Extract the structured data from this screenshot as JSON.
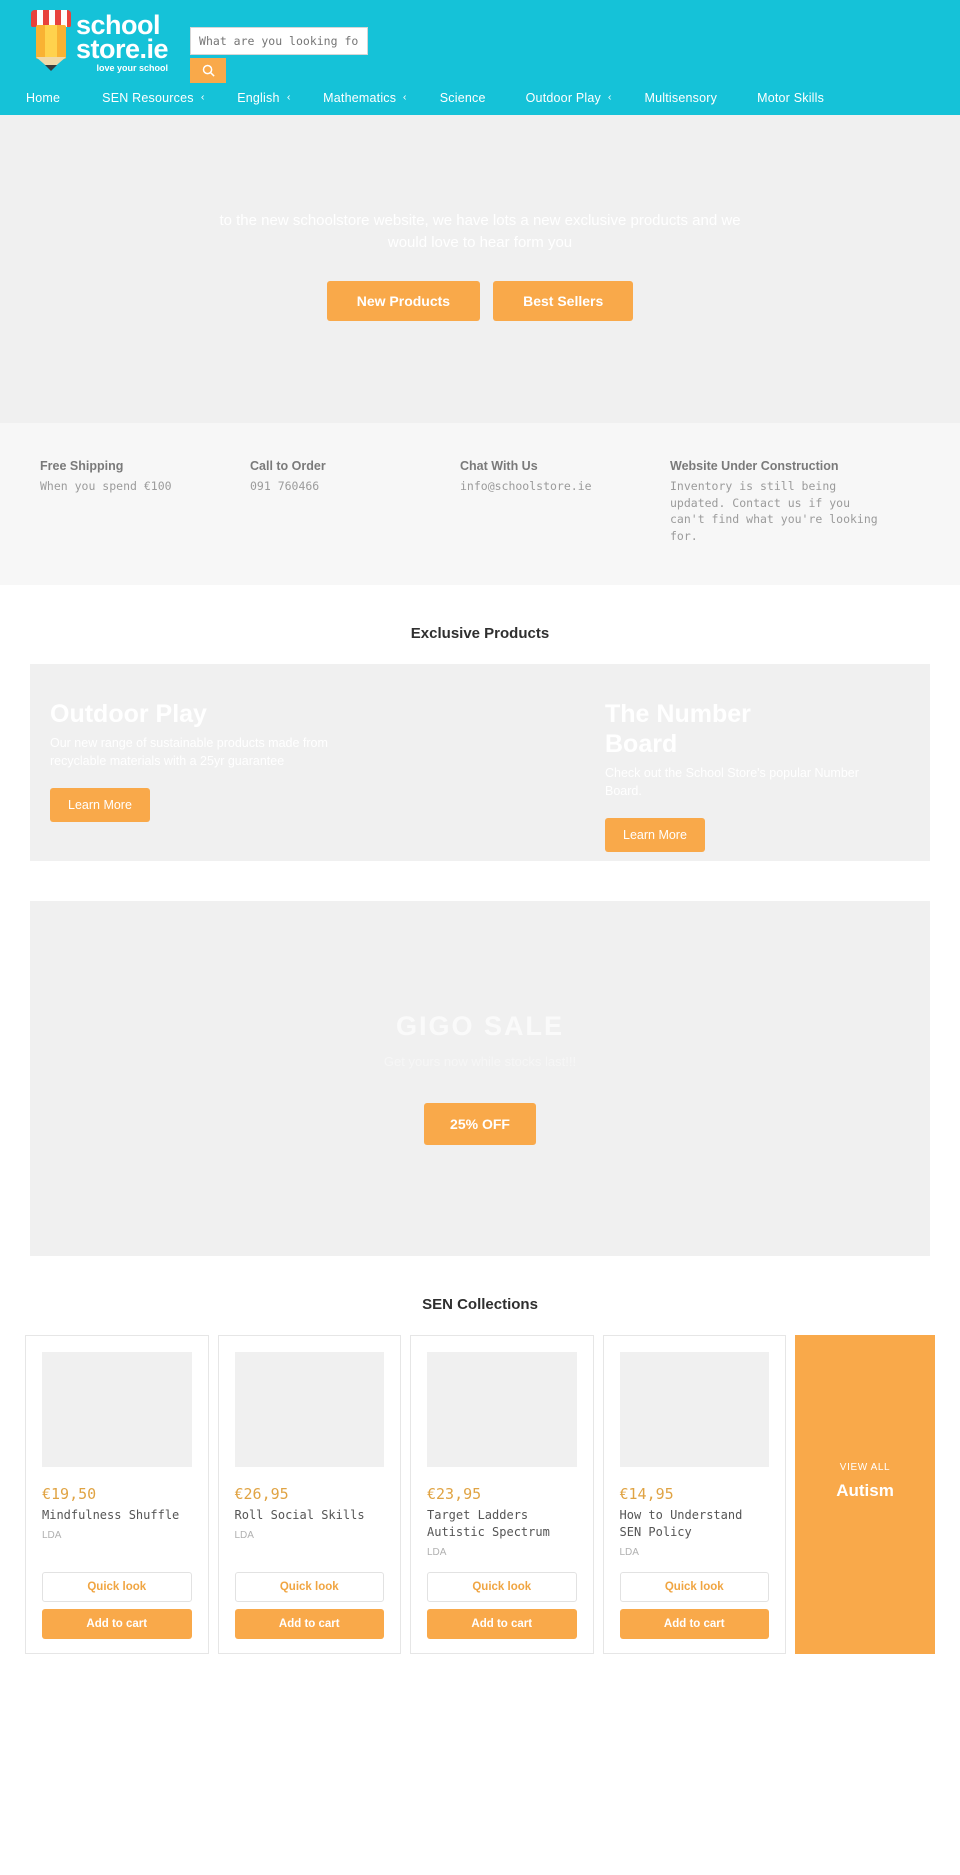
{
  "header": {
    "brand_line1": "school",
    "brand_line2": "store.ie",
    "brand_tagline": "love your school",
    "search_placeholder": "What are you looking for?",
    "search_value": "",
    "colors": {
      "teal": "#15c2d8",
      "orange": "#f9a94a",
      "price": "#e0a343"
    }
  },
  "nav": {
    "items": [
      {
        "label": "Home",
        "caret": ""
      },
      {
        "label": "SEN Resources",
        "caret": "‹"
      },
      {
        "label": "English",
        "caret": "‹"
      },
      {
        "label": "Mathematics",
        "caret": "‹"
      },
      {
        "label": "Science",
        "caret": ""
      },
      {
        "label": "Outdoor Play",
        "caret": "‹"
      },
      {
        "label": "Multisensory",
        "caret": ""
      },
      {
        "label": "Motor Skills",
        "caret": ""
      }
    ]
  },
  "hero": {
    "text": "to the new schoolstore website, we have lots a new exclusive products and we would love to hear form you",
    "button_primary": "New Products",
    "button_secondary": "Best Sellers"
  },
  "infobar": {
    "columns": [
      {
        "title": "Free Shipping",
        "sub": "When you spend €100"
      },
      {
        "title": "Call to Order",
        "sub": "091 760466"
      },
      {
        "title": "Chat With Us",
        "sub": "info@schoolstore.ie"
      },
      {
        "title": "Website Under Construction",
        "sub": "Inventory is still being updated. Contact us if you can't find what you're looking for."
      }
    ]
  },
  "exclusive": {
    "heading": "Exclusive Products",
    "banners": [
      {
        "title": "Outdoor Play",
        "body": "Our new range of sustainable products made from recyclable materials with a 25yr guarantee",
        "cta": "Learn More"
      },
      {
        "title": "The Number Board",
        "body": "Check out the School Store's popular Number Board.",
        "cta": "Learn More"
      }
    ]
  },
  "sale": {
    "title": "GIGO SALE",
    "subtitle": "Get yours now while stocks last!!!",
    "cta": "25% OFF"
  },
  "collections": {
    "heading": "SEN Collections",
    "quick_look_label": "Quick look",
    "add_to_cart_label": "Add to cart",
    "products": [
      {
        "price": "€19,50",
        "name": "Mindfulness Shuffle",
        "brand": "LDA"
      },
      {
        "price": "€26,95",
        "name": "Roll Social Skills",
        "brand": "LDA"
      },
      {
        "price": "€23,95",
        "name": "Target Ladders Autistic Spectrum",
        "brand": "LDA"
      },
      {
        "price": "€14,95",
        "name": "How to Understand SEN Policy",
        "brand": "LDA"
      }
    ],
    "view_all": {
      "small": "VIEW ALL",
      "big": "Autism"
    }
  }
}
